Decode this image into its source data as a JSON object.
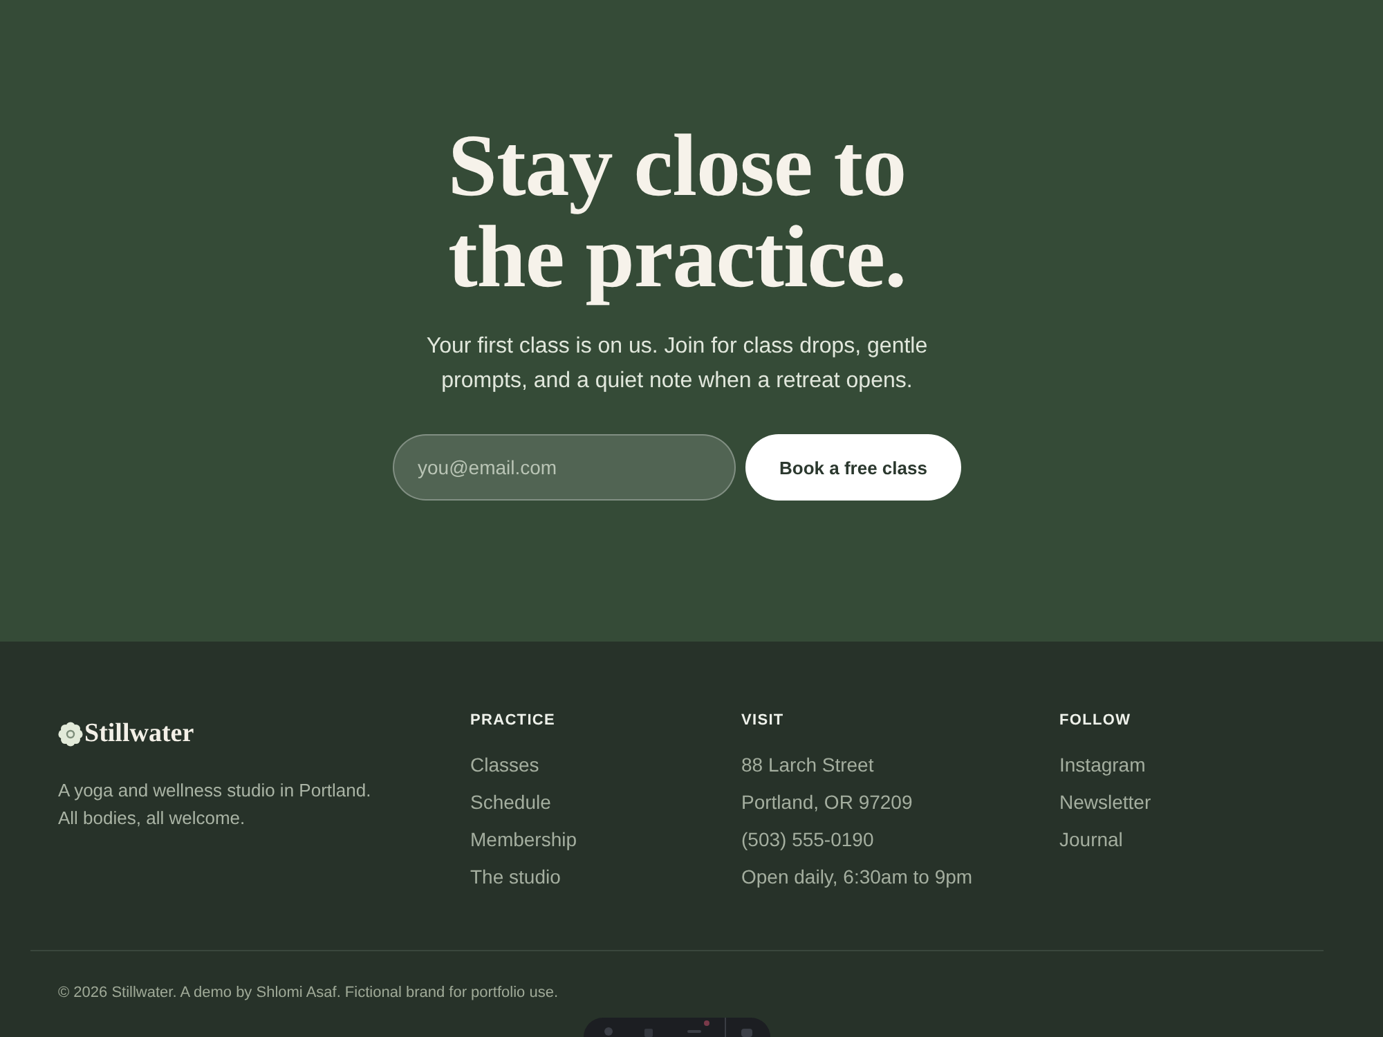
{
  "hero": {
    "title": "Stay close to the practice.",
    "subtitle": "Your first class is on us. Join for class drops, gentle prompts, and a quiet note when a retreat opens.",
    "email_field": {
      "placeholder": "you@email.com"
    },
    "button": "Book a free class"
  },
  "footer": {
    "brand": {
      "name": "Stillwater",
      "tagline": "A yoga and wellness studio in Portland. All bodies, all welcome."
    },
    "columns": [
      {
        "heading": "PRACTICE",
        "links": [
          "Classes",
          "Schedule",
          "Membership",
          "The studio"
        ]
      },
      {
        "heading": "VISIT",
        "lines": [
          "88 Larch Street",
          "Portland, OR 97209",
          "(503) 555-0190",
          "Open daily, 6:30am to 9pm"
        ]
      },
      {
        "heading": "FOLLOW",
        "links": [
          "Instagram",
          "Newsletter",
          "Journal"
        ]
      }
    ],
    "copyright": "© 2026 Stillwater. A demo by Shlomi Asaf. Fictional brand for portfolio use."
  }
}
